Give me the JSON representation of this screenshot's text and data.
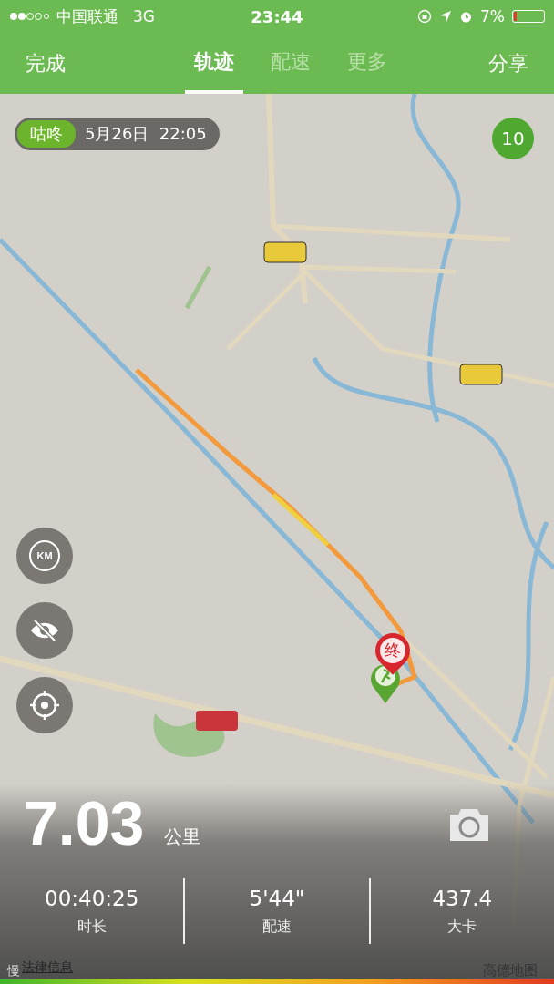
{
  "status_bar": {
    "carrier": "中国联通",
    "network": "3G",
    "time": "23:44",
    "battery": "7%",
    "battery_meter": {
      "level": 0.07
    }
  },
  "nav": {
    "left": "完成",
    "tabs": [
      {
        "label": "轨迹",
        "selected": true
      },
      {
        "label": "配速",
        "selected": false
      },
      {
        "label": "更多",
        "selected": false
      }
    ],
    "right": "分享"
  },
  "map": {
    "session": {
      "tag": "咕咚",
      "datetime": "5月26日  22:05"
    },
    "badge": "10",
    "end_pin": "终",
    "controls": [
      {
        "kind": "km",
        "label": "KM"
      },
      {
        "kind": "hide"
      },
      {
        "kind": "locate"
      }
    ],
    "legal_link": "法律信息",
    "provider": "高德地图",
    "legend_label": "慢"
  },
  "summary": {
    "distance": "7.03",
    "unit": "公里",
    "stats": [
      {
        "value": "00:40:25",
        "label": "时长"
      },
      {
        "value": "5'44\"",
        "label": "配速"
      },
      {
        "value": "437.4",
        "label": "大卡"
      }
    ]
  }
}
